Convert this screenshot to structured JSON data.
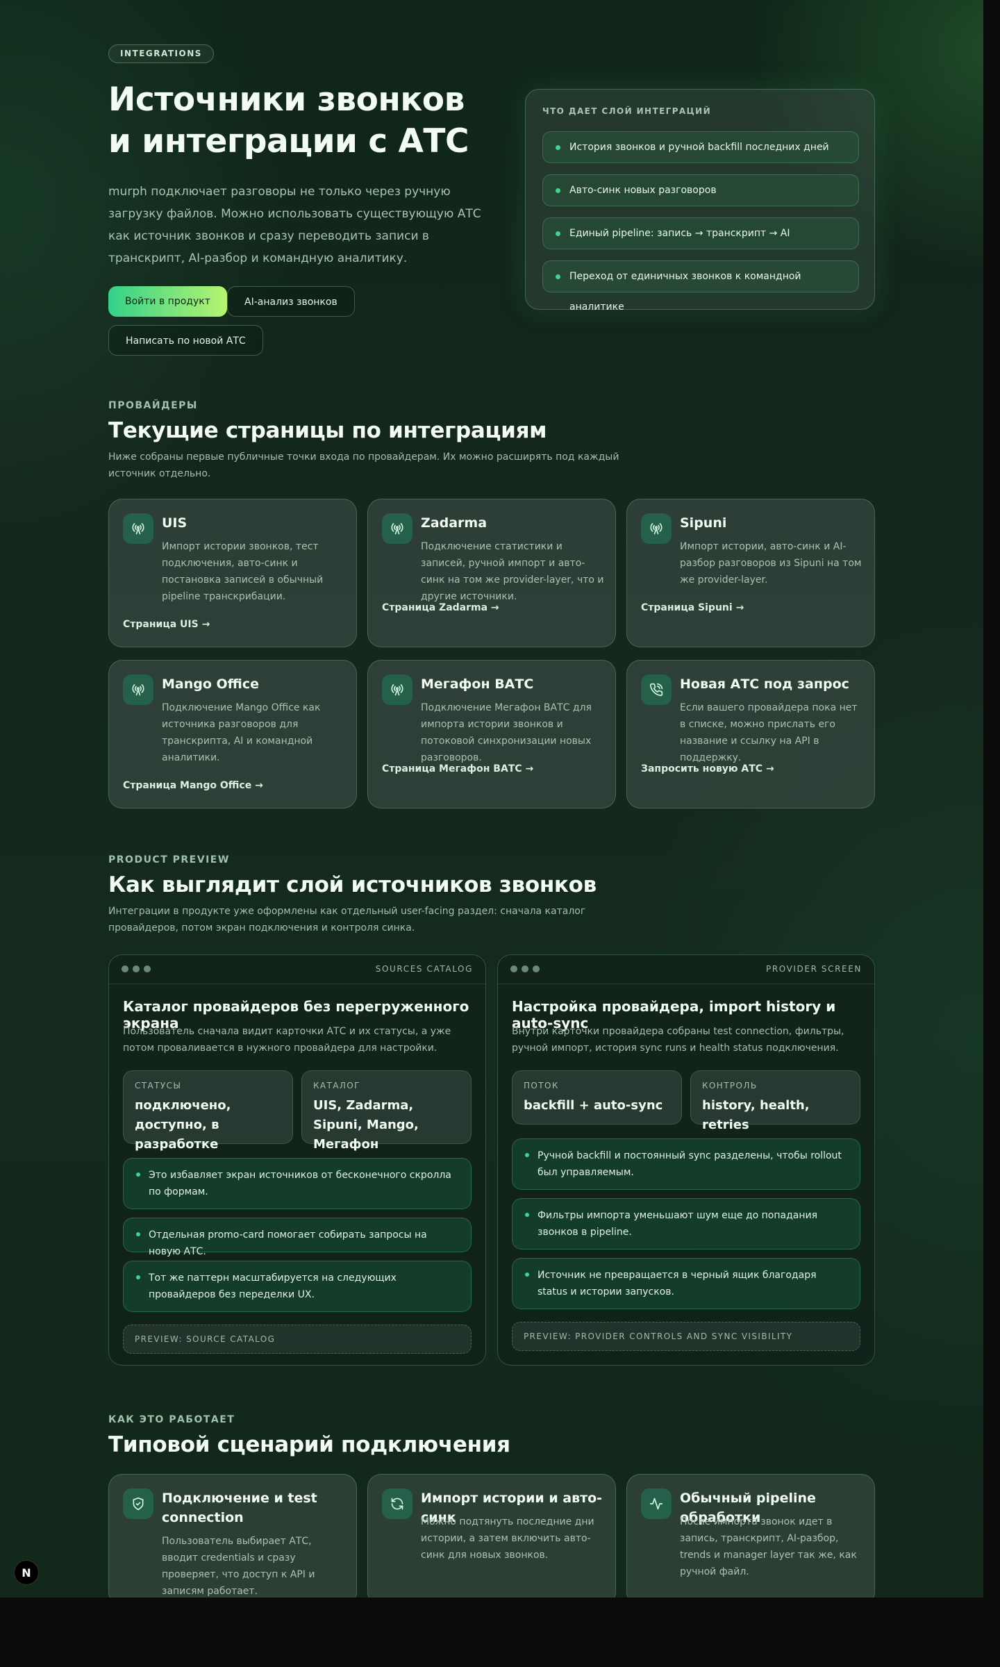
{
  "hero": {
    "badge": "INTEGRATIONS",
    "title": "Источники звонков и интеграции с АТС",
    "lead": "murph подключает разговоры не только через ручную загрузку файлов. Можно использовать существующую АТС как источник звонков и сразу переводить записи в транскрипт, AI-разбор и командную аналитику.",
    "buttons": {
      "login": "Войти в продукт",
      "ai": "AI-анализ звонков",
      "write": "Написать по новой АТС"
    },
    "panel": {
      "title": "ЧТО ДАЕТ СЛОЙ ИНТЕГРАЦИЙ",
      "items": [
        "История звонков и ручной backfill последних дней",
        "Авто-синк новых разговоров",
        "Единый pipeline: запись → транскрипт → AI",
        "Переход от единичных звонков к командной аналитике"
      ]
    }
  },
  "providers": {
    "eyebrow": "ПРОВАЙДЕРЫ",
    "title": "Текущие страницы по интеграциям",
    "sub": "Ниже собраны первые публичные точки входа по провайдерам. Их можно расширять под каждый источник отдельно.",
    "cards": [
      {
        "title": "UIS",
        "desc": "Импорт истории звонков, тест подключения, авто-синк и постановка записей в обычный pipeline транскрибации.",
        "link": "Страница UIS",
        "icon": "antenna-icon"
      },
      {
        "title": "Zadarma",
        "desc": "Подключение статистики и записей, ручной импорт и авто-синк на том же provider-layer, что и другие источники.",
        "link": "Страница Zadarma",
        "icon": "antenna-icon"
      },
      {
        "title": "Sipuni",
        "desc": "Импорт истории, авто-синк и AI-разбор разговоров из Sipuni на том же provider-layer.",
        "link": "Страница Sipuni",
        "icon": "antenna-icon"
      },
      {
        "title": "Mango Office",
        "desc": "Подключение Mango Office как источника разговоров для транскрипта, AI и командной аналитики.",
        "link": "Страница Mango Office",
        "icon": "antenna-icon"
      },
      {
        "title": "Мегафон ВАТС",
        "desc": "Подключение Мегафон ВАТС для импорта истории звонков и потоковой синхронизации новых разговоров.",
        "link": "Страница Мегафон ВАТС",
        "icon": "antenna-icon"
      },
      {
        "title": "Новая АТС под запрос",
        "desc": "Если вашего провайдера пока нет в списке, можно прислать его название и ссылку на API в поддержку.",
        "link": "Запросить новую АТС",
        "icon": "phone-call-icon"
      }
    ]
  },
  "preview": {
    "eyebrow": "PRODUCT PREVIEW",
    "title": "Как выглядит слой источников звонков",
    "sub": "Интеграции в продукте уже оформлены как отдельный user-facing раздел: сначала каталог провайдеров, потом экран подключения и контроля синка.",
    "left": {
      "tag": "SOURCES CATALOG",
      "title": "Каталог провайдеров без перегруженного экрана",
      "desc": "Пользователь сначала видит карточки АТС и их статусы, а уже потом проваливается в нужного провайдера для настройки.",
      "stats": [
        {
          "label": "СТАТУСЫ",
          "value": "подключено, доступно, в разработке"
        },
        {
          "label": "КАТАЛОГ",
          "value": "UIS, Zadarma, Sipuni, Mango, Мегафон"
        }
      ],
      "bullets": [
        "Это избавляет экран источников от бесконечного скролла по формам.",
        "Отдельная promo-card помогает собирать запросы на новую АТС.",
        "Тот же паттерн масштабируется на следующих провайдеров без переделки UX."
      ],
      "footer": "PREVIEW: SOURCE CATALOG"
    },
    "right": {
      "tag": "PROVIDER SCREEN",
      "title": "Настройка провайдера, import history и auto-sync",
      "desc": "Внутри карточки провайдера собраны test connection, фильтры, ручной импорт, история sync runs и health status подключения.",
      "stats": [
        {
          "label": "ПОТОК",
          "value": "backfill + auto-sync"
        },
        {
          "label": "КОНТРОЛЬ",
          "value": "history, health, retries"
        }
      ],
      "bullets": [
        "Ручной backfill и постоянный sync разделены, чтобы rollout был управляемым.",
        "Фильтры импорта уменьшают шум еще до попадания звонков в pipeline.",
        "Источник не превращается в черный ящик благодаря status и истории запусков."
      ],
      "footer": "PREVIEW: PROVIDER CONTROLS AND SYNC VISIBILITY"
    }
  },
  "how": {
    "eyebrow": "КАК ЭТО РАБОТАЕТ",
    "title": "Типовой сценарий подключения",
    "cards": [
      {
        "title": "Подключение и test connection",
        "desc": "Пользователь выбирает АТС, вводит credentials и сразу проверяет, что доступ к API и записям работает.",
        "icon": "shield-check-icon"
      },
      {
        "title": "Импорт истории и авто-синк",
        "desc": "Можно подтянуть последние дни истории, а затем включить авто-синк для новых звонков.",
        "icon": "refresh-icon"
      },
      {
        "title": "Обычный pipeline обработки",
        "desc": "После импорта звонок идет в запись, транскрипт, AI-разбор, trends и manager layer так же, как ручной файл.",
        "icon": "activity-icon"
      }
    ]
  },
  "badge_logo": "N",
  "colors": {
    "accent": "#3fd68c",
    "accent_end": "#b7f470",
    "bg": "#142a1e"
  }
}
